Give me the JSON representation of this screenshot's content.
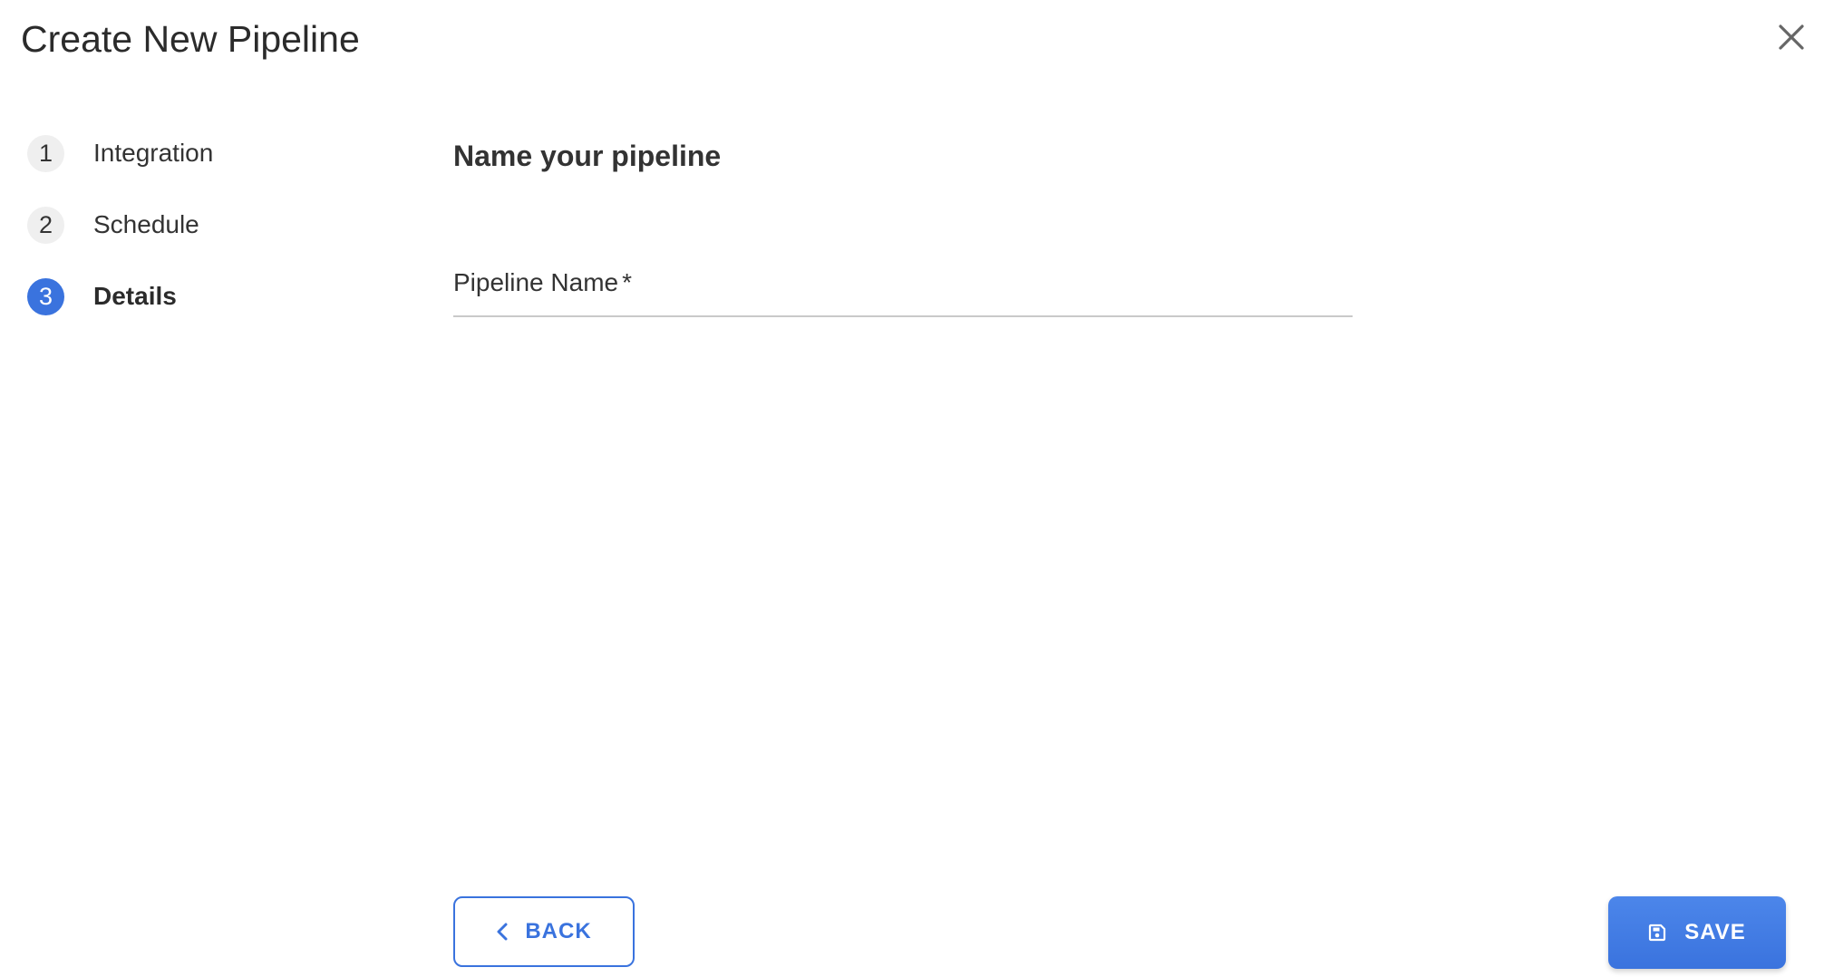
{
  "dialog": {
    "title": "Create New Pipeline",
    "close_icon": "close-icon"
  },
  "stepper": {
    "steps": [
      {
        "number": "1",
        "label": "Integration",
        "active": false
      },
      {
        "number": "2",
        "label": "Schedule",
        "active": false
      },
      {
        "number": "3",
        "label": "Details",
        "active": true
      }
    ]
  },
  "main": {
    "section_title": "Name your pipeline",
    "pipeline_name_field": {
      "label": "Pipeline Name",
      "required_mark": "*",
      "value": ""
    }
  },
  "footer": {
    "back_label": "BACK",
    "back_icon": "chevron-left-icon",
    "save_label": "SAVE",
    "save_icon": "save-icon"
  },
  "colors": {
    "accent": "#3a73de",
    "step_inactive_bg": "#efefef",
    "text": "#2b2b2b",
    "divider": "#c9c9c9"
  }
}
